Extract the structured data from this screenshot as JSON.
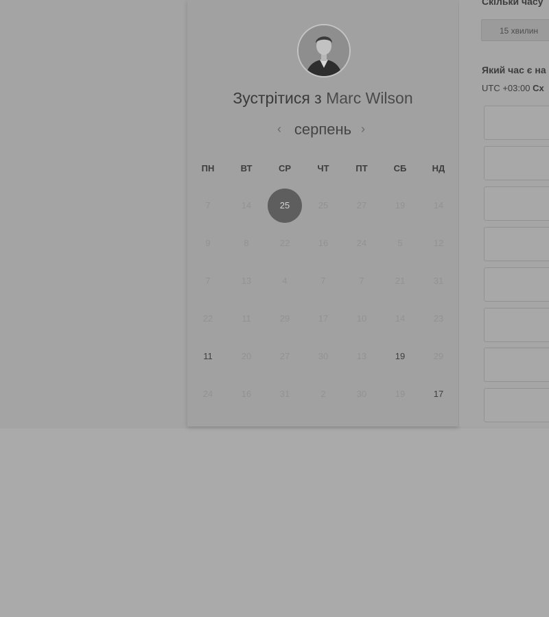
{
  "scheduler": {
    "title_prefix": "Зустрітися з",
    "host_name": "Marc Wilson",
    "month": "серпень",
    "prev_icon": "chevron-left-icon",
    "next_icon": "chevron-right-icon",
    "weekdays": [
      "ПН",
      "ВТ",
      "СР",
      "ЧТ",
      "ПТ",
      "СБ",
      "НД"
    ],
    "weeks": [
      [
        "7",
        "14",
        "25",
        "25",
        "27",
        "19",
        "14"
      ],
      [
        "9",
        "8",
        "22",
        "16",
        "24",
        "5",
        "12"
      ],
      [
        "7",
        "13",
        "4",
        "7",
        "7",
        "21",
        "31"
      ],
      [
        "22",
        "11",
        "29",
        "17",
        "10",
        "14",
        "23"
      ],
      [
        "11",
        "20",
        "27",
        "30",
        "13",
        "19",
        "29"
      ],
      [
        "24",
        "16",
        "31",
        "2",
        "30",
        "19",
        "17"
      ]
    ],
    "selected_day": "25"
  },
  "booking": {
    "duration_question": "Скільки часу",
    "duration_option": "15 хвилин",
    "time_question": "Який час є на",
    "timezone_prefix": "UTC +03:00",
    "timezone_name": "Сх"
  }
}
